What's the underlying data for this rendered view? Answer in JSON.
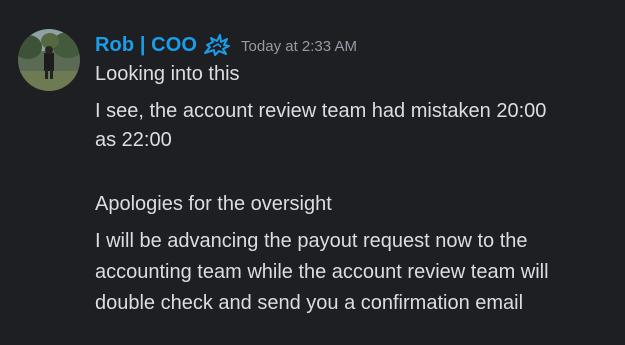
{
  "message": {
    "author": "Rob | COO",
    "timestamp": "Today at 2:33 AM",
    "role_icon": "wolf-emblem-icon",
    "author_color": "#1a9eea",
    "lines": [
      "Looking into this",
      "I see, the account review team had mistaken 20:00",
      "as 22:00",
      "",
      "Apologies for the oversight",
      "I will be advancing the payout request now to the",
      "accounting team while the account review team will",
      "double check and send you a confirmation email"
    ]
  },
  "colors": {
    "background": "#1e1f22",
    "text": "#dbdee1",
    "timestamp": "#949ba4"
  }
}
